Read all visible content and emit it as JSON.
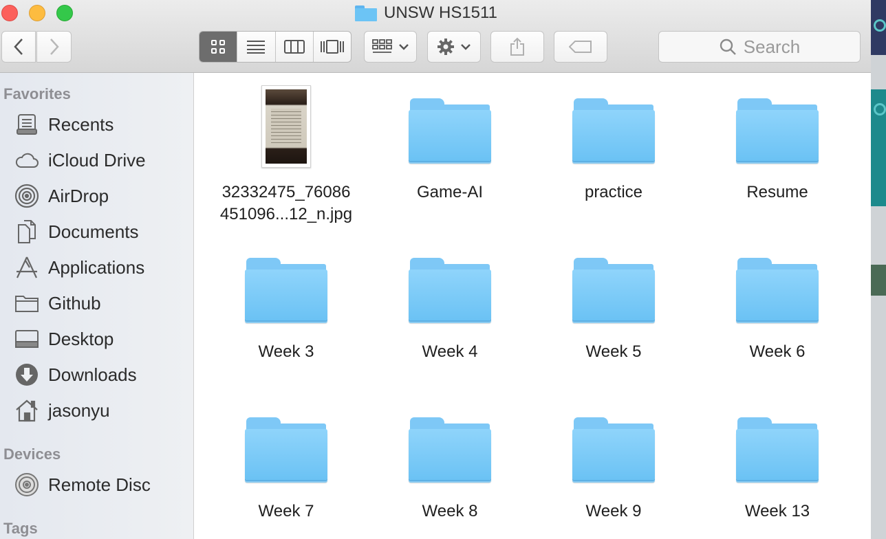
{
  "window": {
    "title": "UNSW HS1511"
  },
  "toolbar": {
    "search_placeholder": "Search",
    "view_modes": [
      "icon",
      "list",
      "column",
      "cover-flow"
    ],
    "active_view": "icon"
  },
  "sidebar": {
    "favorites_header": "Favorites",
    "favorites": [
      {
        "label": "Recents",
        "icon": "recents-icon"
      },
      {
        "label": "iCloud Drive",
        "icon": "cloud-icon"
      },
      {
        "label": "AirDrop",
        "icon": "airdrop-icon"
      },
      {
        "label": "Documents",
        "icon": "documents-icon"
      },
      {
        "label": "Applications",
        "icon": "applications-icon"
      },
      {
        "label": "Github",
        "icon": "folder-icon"
      },
      {
        "label": "Desktop",
        "icon": "desktop-icon"
      },
      {
        "label": "Downloads",
        "icon": "downloads-icon"
      },
      {
        "label": "jasonyu",
        "icon": "home-icon"
      }
    ],
    "devices_header": "Devices",
    "devices": [
      {
        "label": "Remote Disc",
        "icon": "disc-icon"
      }
    ],
    "tags_header": "Tags"
  },
  "files": [
    {
      "kind": "image",
      "label_line1": "32332475_76086",
      "label_line2": "451096...12_n.jpg"
    },
    {
      "kind": "folder",
      "label": "Game-AI"
    },
    {
      "kind": "folder",
      "label": "practice"
    },
    {
      "kind": "folder",
      "label": "Resume"
    },
    {
      "kind": "folder",
      "label": "Week 3"
    },
    {
      "kind": "folder",
      "label": "Week 4"
    },
    {
      "kind": "folder",
      "label": "Week 5"
    },
    {
      "kind": "folder",
      "label": "Week 6"
    },
    {
      "kind": "folder",
      "label": "Week 7"
    },
    {
      "kind": "folder",
      "label": "Week 8"
    },
    {
      "kind": "folder",
      "label": "Week 9"
    },
    {
      "kind": "folder",
      "label": "Week 13"
    }
  ],
  "colors": {
    "folder": "#7ec8f6",
    "close": "#fc605b",
    "minimize": "#fdbc40",
    "maximize": "#34c84a"
  }
}
